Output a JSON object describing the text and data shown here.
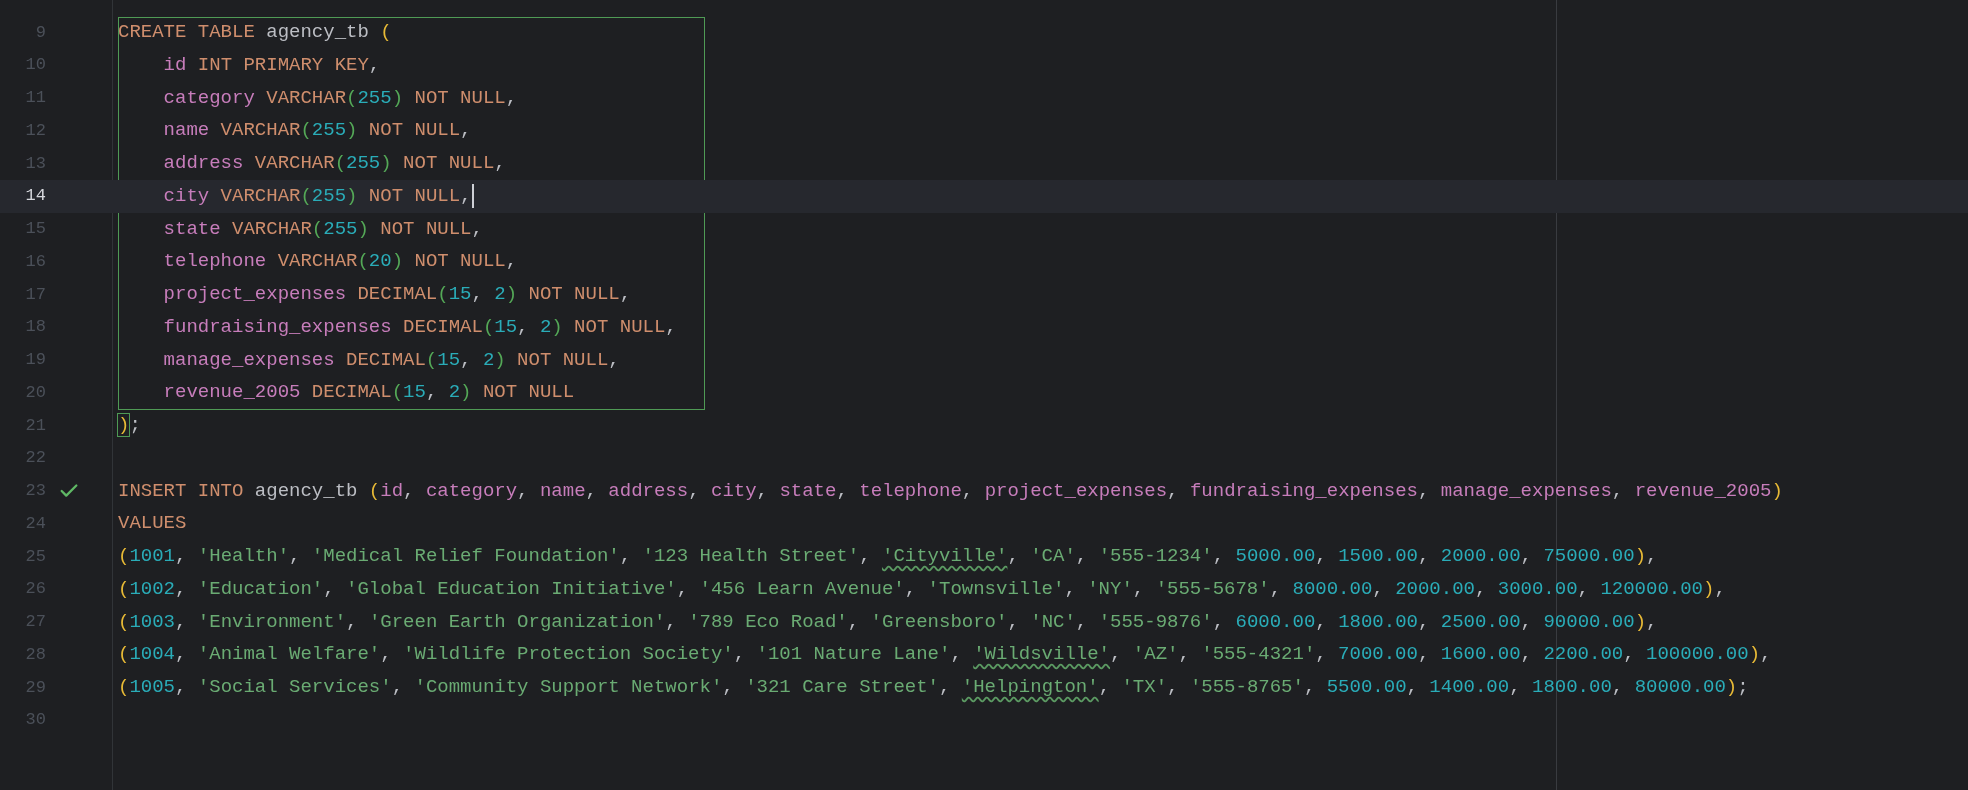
{
  "lines": [
    {
      "number": "9",
      "kind": "scope",
      "selected": false,
      "check": false,
      "tokens": [
        {
          "kind": "kw",
          "text": "CREATE TABLE "
        },
        {
          "kind": "ident",
          "text": "agency_tb "
        },
        {
          "kind": "paren1",
          "text": "("
        }
      ]
    },
    {
      "number": "10",
      "kind": "scope",
      "selected": false,
      "check": false,
      "tokens": [
        {
          "kind": "col",
          "text": "    id"
        },
        {
          "kind": "kw",
          "text": " INT PRIMARY KEY"
        },
        {
          "kind": "punct",
          "text": ","
        }
      ]
    },
    {
      "number": "11",
      "kind": "scope",
      "selected": false,
      "check": false,
      "tokens": [
        {
          "kind": "col",
          "text": "    category"
        },
        {
          "kind": "kw",
          "text": " VARCHAR"
        },
        {
          "kind": "paren2",
          "text": "("
        },
        {
          "kind": "num",
          "text": "255"
        },
        {
          "kind": "paren2",
          "text": ")"
        },
        {
          "kind": "kw",
          "text": " NOT NULL"
        },
        {
          "kind": "punct",
          "text": ","
        }
      ]
    },
    {
      "number": "12",
      "kind": "scope",
      "selected": false,
      "check": false,
      "tokens": [
        {
          "kind": "col",
          "text": "    name"
        },
        {
          "kind": "kw",
          "text": " VARCHAR"
        },
        {
          "kind": "paren2",
          "text": "("
        },
        {
          "kind": "num",
          "text": "255"
        },
        {
          "kind": "paren2",
          "text": ")"
        },
        {
          "kind": "kw",
          "text": " NOT NULL"
        },
        {
          "kind": "punct",
          "text": ","
        }
      ]
    },
    {
      "number": "13",
      "kind": "scope",
      "selected": false,
      "check": false,
      "tokens": [
        {
          "kind": "col",
          "text": "    address"
        },
        {
          "kind": "kw",
          "text": " VARCHAR"
        },
        {
          "kind": "paren2",
          "text": "("
        },
        {
          "kind": "num",
          "text": "255"
        },
        {
          "kind": "paren2",
          "text": ")"
        },
        {
          "kind": "kw",
          "text": " NOT NULL"
        },
        {
          "kind": "punct",
          "text": ","
        }
      ]
    },
    {
      "number": "14",
      "kind": "scope",
      "selected": true,
      "check": false,
      "tokens": [
        {
          "kind": "col",
          "text": "    city"
        },
        {
          "kind": "kw",
          "text": " VARCHAR"
        },
        {
          "kind": "paren2",
          "text": "("
        },
        {
          "kind": "num",
          "text": "255"
        },
        {
          "kind": "paren2",
          "text": ")"
        },
        {
          "kind": "kw",
          "text": " NOT NULL"
        },
        {
          "kind": "punct",
          "text": ","
        }
      ]
    },
    {
      "number": "15",
      "kind": "scope",
      "selected": false,
      "check": false,
      "tokens": [
        {
          "kind": "col",
          "text": "    state"
        },
        {
          "kind": "kw",
          "text": " VARCHAR"
        },
        {
          "kind": "paren2",
          "text": "("
        },
        {
          "kind": "num",
          "text": "255"
        },
        {
          "kind": "paren2",
          "text": ")"
        },
        {
          "kind": "kw",
          "text": " NOT NULL"
        },
        {
          "kind": "punct",
          "text": ","
        }
      ]
    },
    {
      "number": "16",
      "kind": "scope",
      "selected": false,
      "check": false,
      "tokens": [
        {
          "kind": "col",
          "text": "    telephone"
        },
        {
          "kind": "kw",
          "text": " VARCHAR"
        },
        {
          "kind": "paren2",
          "text": "("
        },
        {
          "kind": "num",
          "text": "20"
        },
        {
          "kind": "paren2",
          "text": ")"
        },
        {
          "kind": "kw",
          "text": " NOT NULL"
        },
        {
          "kind": "punct",
          "text": ","
        }
      ]
    },
    {
      "number": "17",
      "kind": "scope",
      "selected": false,
      "check": false,
      "tokens": [
        {
          "kind": "col",
          "text": "    project_expenses"
        },
        {
          "kind": "kw",
          "text": " DECIMAL"
        },
        {
          "kind": "paren2",
          "text": "("
        },
        {
          "kind": "num",
          "text": "15"
        },
        {
          "kind": "punct",
          "text": ", "
        },
        {
          "kind": "num",
          "text": "2"
        },
        {
          "kind": "paren2",
          "text": ")"
        },
        {
          "kind": "kw",
          "text": " NOT NULL"
        },
        {
          "kind": "punct",
          "text": ","
        }
      ]
    },
    {
      "number": "18",
      "kind": "scope",
      "selected": false,
      "check": false,
      "tokens": [
        {
          "kind": "col",
          "text": "    fundraising_expenses"
        },
        {
          "kind": "kw",
          "text": " DECIMAL"
        },
        {
          "kind": "paren2",
          "text": "("
        },
        {
          "kind": "num",
          "text": "15"
        },
        {
          "kind": "punct",
          "text": ", "
        },
        {
          "kind": "num",
          "text": "2"
        },
        {
          "kind": "paren2",
          "text": ")"
        },
        {
          "kind": "kw",
          "text": " NOT NULL"
        },
        {
          "kind": "punct",
          "text": ","
        }
      ]
    },
    {
      "number": "19",
      "kind": "scope",
      "selected": false,
      "check": false,
      "tokens": [
        {
          "kind": "col",
          "text": "    manage_expenses"
        },
        {
          "kind": "kw",
          "text": " DECIMAL"
        },
        {
          "kind": "paren2",
          "text": "("
        },
        {
          "kind": "num",
          "text": "15"
        },
        {
          "kind": "punct",
          "text": ", "
        },
        {
          "kind": "num",
          "text": "2"
        },
        {
          "kind": "paren2",
          "text": ")"
        },
        {
          "kind": "kw",
          "text": " NOT NULL"
        },
        {
          "kind": "punct",
          "text": ","
        }
      ]
    },
    {
      "number": "20",
      "kind": "scope",
      "selected": false,
      "check": false,
      "tokens": [
        {
          "kind": "col",
          "text": "    revenue_2005"
        },
        {
          "kind": "kw",
          "text": " DECIMAL"
        },
        {
          "kind": "paren2",
          "text": "("
        },
        {
          "kind": "num",
          "text": "15"
        },
        {
          "kind": "punct",
          "text": ", "
        },
        {
          "kind": "num",
          "text": "2"
        },
        {
          "kind": "paren2",
          "text": ")"
        },
        {
          "kind": "kw",
          "text": " NOT NULL"
        }
      ]
    },
    {
      "number": "21",
      "kind": "plain",
      "selected": false,
      "check": false,
      "tokens": [
        {
          "kind": "paren1_match",
          "text": ")"
        },
        {
          "kind": "punct",
          "text": ";"
        }
      ]
    },
    {
      "number": "22",
      "kind": "plain",
      "selected": false,
      "check": false
    },
    {
      "number": "23",
      "kind": "plain",
      "selected": false,
      "check": true,
      "tokens": [
        {
          "kind": "kw",
          "text": "INSERT INTO "
        },
        {
          "kind": "ident",
          "text": "agency_tb "
        },
        {
          "kind": "paren1",
          "text": "("
        },
        {
          "kind": "col",
          "text": "id"
        },
        {
          "kind": "punct",
          "text": ", "
        },
        {
          "kind": "col",
          "text": "category"
        },
        {
          "kind": "punct",
          "text": ", "
        },
        {
          "kind": "col",
          "text": "name"
        },
        {
          "kind": "punct",
          "text": ", "
        },
        {
          "kind": "col",
          "text": "address"
        },
        {
          "kind": "punct",
          "text": ", "
        },
        {
          "kind": "col",
          "text": "city"
        },
        {
          "kind": "punct",
          "text": ", "
        },
        {
          "kind": "col",
          "text": "state"
        },
        {
          "kind": "punct",
          "text": ", "
        },
        {
          "kind": "col",
          "text": "telephone"
        },
        {
          "kind": "punct",
          "text": ", "
        },
        {
          "kind": "col",
          "text": "project_expenses"
        },
        {
          "kind": "punct",
          "text": ", "
        },
        {
          "kind": "col",
          "text": "fundraising_expenses"
        },
        {
          "kind": "punct",
          "text": ", "
        },
        {
          "kind": "col",
          "text": "manage_expenses"
        },
        {
          "kind": "punct",
          "text": ", "
        },
        {
          "kind": "col",
          "text": "revenue_2005"
        },
        {
          "kind": "paren1",
          "text": ")"
        }
      ]
    },
    {
      "number": "24",
      "kind": "plain",
      "selected": false,
      "check": false,
      "tokens": [
        {
          "kind": "kw",
          "text": "VALUES"
        }
      ]
    },
    {
      "number": "25",
      "kind": "plain",
      "selected": false,
      "check": false,
      "tokens": [
        {
          "kind": "paren1",
          "text": "("
        },
        {
          "kind": "num",
          "text": "1001"
        },
        {
          "kind": "punct",
          "text": ", "
        },
        {
          "kind": "str",
          "text": "'Health'"
        },
        {
          "kind": "punct",
          "text": ", "
        },
        {
          "kind": "str",
          "text": "'Medical Relief Foundation'"
        },
        {
          "kind": "punct",
          "text": ", "
        },
        {
          "kind": "str",
          "text": "'123 Health Street'"
        },
        {
          "kind": "punct",
          "text": ", "
        },
        {
          "kind": "str_misspelled",
          "text": "'Cityville'"
        },
        {
          "kind": "punct",
          "text": ", "
        },
        {
          "kind": "str",
          "text": "'CA'"
        },
        {
          "kind": "punct",
          "text": ", "
        },
        {
          "kind": "str",
          "text": "'555-1234'"
        },
        {
          "kind": "punct",
          "text": ", "
        },
        {
          "kind": "num",
          "text": "5000.00"
        },
        {
          "kind": "punct",
          "text": ", "
        },
        {
          "kind": "num",
          "text": "1500.00"
        },
        {
          "kind": "punct",
          "text": ", "
        },
        {
          "kind": "num",
          "text": "2000.00"
        },
        {
          "kind": "punct",
          "text": ", "
        },
        {
          "kind": "num",
          "text": "75000.00"
        },
        {
          "kind": "paren1",
          "text": ")"
        },
        {
          "kind": "punct",
          "text": ","
        }
      ]
    },
    {
      "number": "26",
      "kind": "plain",
      "selected": false,
      "check": false,
      "tokens": [
        {
          "kind": "paren1",
          "text": "("
        },
        {
          "kind": "num",
          "text": "1002"
        },
        {
          "kind": "punct",
          "text": ", "
        },
        {
          "kind": "str",
          "text": "'Education'"
        },
        {
          "kind": "punct",
          "text": ", "
        },
        {
          "kind": "str",
          "text": "'Global Education Initiative'"
        },
        {
          "kind": "punct",
          "text": ", "
        },
        {
          "kind": "str",
          "text": "'456 Learn Avenue'"
        },
        {
          "kind": "punct",
          "text": ", "
        },
        {
          "kind": "str",
          "text": "'Townsville'"
        },
        {
          "kind": "punct",
          "text": ", "
        },
        {
          "kind": "str",
          "text": "'NY'"
        },
        {
          "kind": "punct",
          "text": ", "
        },
        {
          "kind": "str",
          "text": "'555-5678'"
        },
        {
          "kind": "punct",
          "text": ", "
        },
        {
          "kind": "num",
          "text": "8000.00"
        },
        {
          "kind": "punct",
          "text": ", "
        },
        {
          "kind": "num",
          "text": "2000.00"
        },
        {
          "kind": "punct",
          "text": ", "
        },
        {
          "kind": "num",
          "text": "3000.00"
        },
        {
          "kind": "punct",
          "text": ", "
        },
        {
          "kind": "num",
          "text": "120000.00"
        },
        {
          "kind": "paren1",
          "text": ")"
        },
        {
          "kind": "punct",
          "text": ","
        }
      ]
    },
    {
      "number": "27",
      "kind": "plain",
      "selected": false,
      "check": false,
      "tokens": [
        {
          "kind": "paren1",
          "text": "("
        },
        {
          "kind": "num",
          "text": "1003"
        },
        {
          "kind": "punct",
          "text": ", "
        },
        {
          "kind": "str",
          "text": "'Environment'"
        },
        {
          "kind": "punct",
          "text": ", "
        },
        {
          "kind": "str",
          "text": "'Green Earth Organization'"
        },
        {
          "kind": "punct",
          "text": ", "
        },
        {
          "kind": "str",
          "text": "'789 Eco Road'"
        },
        {
          "kind": "punct",
          "text": ", "
        },
        {
          "kind": "str",
          "text": "'Greensboro'"
        },
        {
          "kind": "punct",
          "text": ", "
        },
        {
          "kind": "str",
          "text": "'NC'"
        },
        {
          "kind": "punct",
          "text": ", "
        },
        {
          "kind": "str",
          "text": "'555-9876'"
        },
        {
          "kind": "punct",
          "text": ", "
        },
        {
          "kind": "num",
          "text": "6000.00"
        },
        {
          "kind": "punct",
          "text": ", "
        },
        {
          "kind": "num",
          "text": "1800.00"
        },
        {
          "kind": "punct",
          "text": ", "
        },
        {
          "kind": "num",
          "text": "2500.00"
        },
        {
          "kind": "punct",
          "text": ", "
        },
        {
          "kind": "num",
          "text": "90000.00"
        },
        {
          "kind": "paren1",
          "text": ")"
        },
        {
          "kind": "punct",
          "text": ","
        }
      ]
    },
    {
      "number": "28",
      "kind": "plain",
      "selected": false,
      "check": false,
      "tokens": [
        {
          "kind": "paren1",
          "text": "("
        },
        {
          "kind": "num",
          "text": "1004"
        },
        {
          "kind": "punct",
          "text": ", "
        },
        {
          "kind": "str",
          "text": "'Animal Welfare'"
        },
        {
          "kind": "punct",
          "text": ", "
        },
        {
          "kind": "str",
          "text": "'Wildlife Protection Society'"
        },
        {
          "kind": "punct",
          "text": ", "
        },
        {
          "kind": "str",
          "text": "'101 Nature Lane'"
        },
        {
          "kind": "punct",
          "text": ", "
        },
        {
          "kind": "str_misspelled",
          "text": "'Wildsville'"
        },
        {
          "kind": "punct",
          "text": ", "
        },
        {
          "kind": "str",
          "text": "'AZ'"
        },
        {
          "kind": "punct",
          "text": ", "
        },
        {
          "kind": "str",
          "text": "'555-4321'"
        },
        {
          "kind": "punct",
          "text": ", "
        },
        {
          "kind": "num",
          "text": "7000.00"
        },
        {
          "kind": "punct",
          "text": ", "
        },
        {
          "kind": "num",
          "text": "1600.00"
        },
        {
          "kind": "punct",
          "text": ", "
        },
        {
          "kind": "num",
          "text": "2200.00"
        },
        {
          "kind": "punct",
          "text": ", "
        },
        {
          "kind": "num",
          "text": "100000.00"
        },
        {
          "kind": "paren1",
          "text": ")"
        },
        {
          "kind": "punct",
          "text": ","
        }
      ]
    },
    {
      "number": "29",
      "kind": "plain",
      "selected": false,
      "check": false,
      "tokens": [
        {
          "kind": "paren1",
          "text": "("
        },
        {
          "kind": "num",
          "text": "1005"
        },
        {
          "kind": "punct",
          "text": ", "
        },
        {
          "kind": "str",
          "text": "'Social Services'"
        },
        {
          "kind": "punct",
          "text": ", "
        },
        {
          "kind": "str",
          "text": "'Community Support Network'"
        },
        {
          "kind": "punct",
          "text": ", "
        },
        {
          "kind": "str",
          "text": "'321 Care Street'"
        },
        {
          "kind": "punct",
          "text": ", "
        },
        {
          "kind": "str_misspelled",
          "text": "'Helpington'"
        },
        {
          "kind": "punct",
          "text": ", "
        },
        {
          "kind": "str",
          "text": "'TX'"
        },
        {
          "kind": "punct",
          "text": ", "
        },
        {
          "kind": "str",
          "text": "'555-8765'"
        },
        {
          "kind": "punct",
          "text": ", "
        },
        {
          "kind": "num",
          "text": "5500.00"
        },
        {
          "kind": "punct",
          "text": ", "
        },
        {
          "kind": "num",
          "text": "1400.00"
        },
        {
          "kind": "punct",
          "text": ", "
        },
        {
          "kind": "num",
          "text": "1800.00"
        },
        {
          "kind": "punct",
          "text": ", "
        },
        {
          "kind": "num",
          "text": "80000.00"
        },
        {
          "kind": "paren1",
          "text": ")"
        },
        {
          "kind": "punct",
          "text": ";"
        }
      ]
    },
    {
      "number": "30",
      "kind": "plain",
      "selected": false,
      "check": false
    }
  ]
}
